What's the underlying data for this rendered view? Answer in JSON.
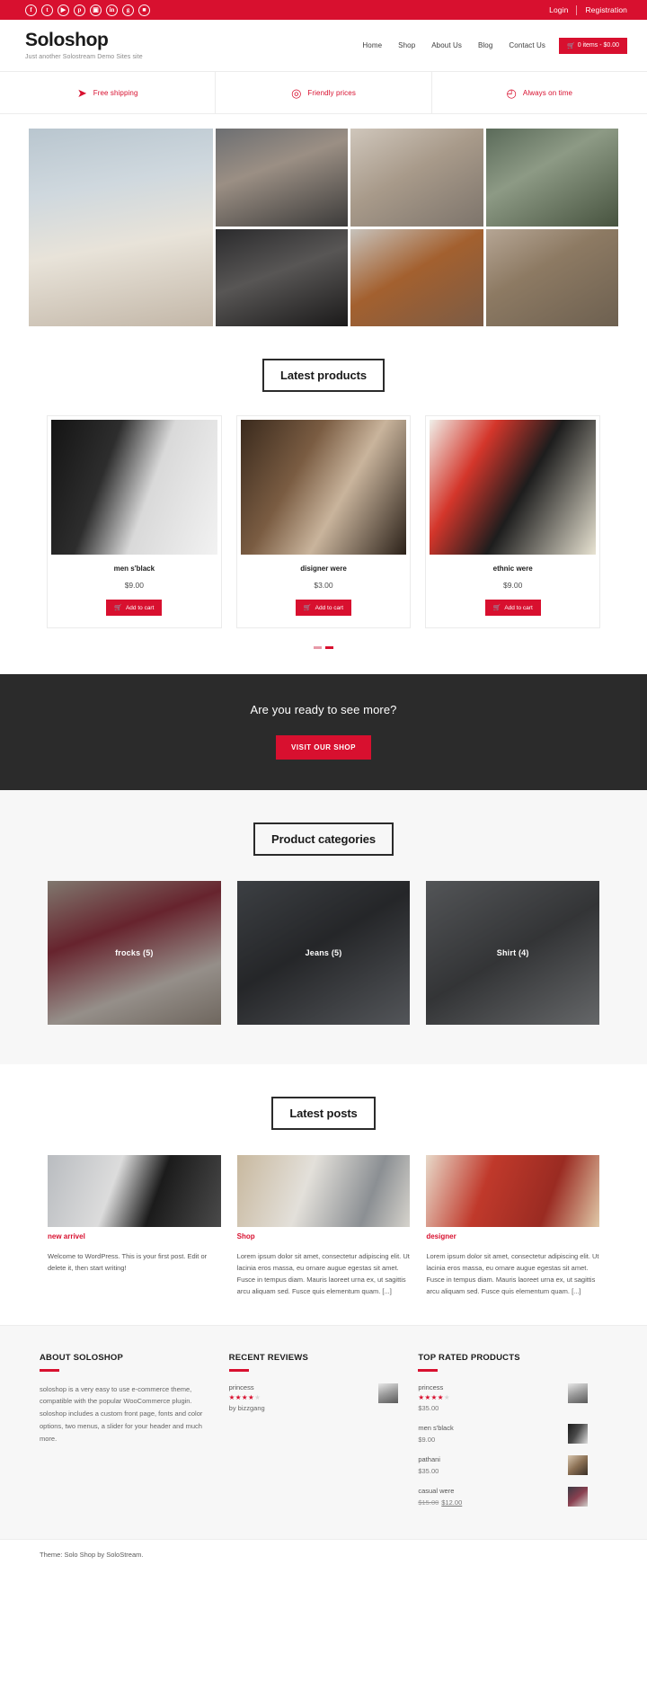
{
  "topbar": {
    "social": [
      {
        "name": "facebook-icon",
        "glyph": "f"
      },
      {
        "name": "twitter-icon",
        "glyph": "t"
      },
      {
        "name": "youtube-icon",
        "glyph": "▶"
      },
      {
        "name": "pinterest-icon",
        "glyph": "p"
      },
      {
        "name": "instagram-icon",
        "glyph": "▣"
      },
      {
        "name": "linkedin-icon",
        "glyph": "in"
      },
      {
        "name": "googleplus-icon",
        "glyph": "g"
      },
      {
        "name": "rss-icon",
        "glyph": "■"
      }
    ],
    "login": "Login",
    "registration": "Registration"
  },
  "header": {
    "site_title": "Soloshop",
    "tagline": "Just another Solostream Demo Sites site",
    "nav": [
      "Home",
      "Shop",
      "About Us",
      "Blog",
      "Contact Us"
    ],
    "cart": {
      "icon": "cart-icon",
      "label": "0 items - $0.00"
    }
  },
  "features": [
    {
      "icon": "rocket-icon",
      "glyph": "➤",
      "label": "Free shipping"
    },
    {
      "icon": "money-icon",
      "glyph": "◎",
      "label": "Friendly prices"
    },
    {
      "icon": "clock-icon",
      "glyph": "◴",
      "label": "Always on time"
    }
  ],
  "products_section": {
    "heading": "Latest products",
    "items": [
      {
        "name": "men s'black",
        "price": "$9.00",
        "button": "Add to cart",
        "img": "p1"
      },
      {
        "name": "disigner were",
        "price": "$3.00",
        "button": "Add to cart",
        "img": "p2"
      },
      {
        "name": "ethnic were",
        "price": "$9.00",
        "button": "Add to cart",
        "img": "p3"
      }
    ],
    "dots": 2,
    "active_dot": 1
  },
  "cta": {
    "title": "Are you ready to see more?",
    "button": "VISIT OUR SHOP"
  },
  "categories_section": {
    "heading": "Product categories",
    "items": [
      {
        "label": "frocks  (5)",
        "img": "c1"
      },
      {
        "label": "Jeans  (5)",
        "img": "c2"
      },
      {
        "label": "Shirt  (4)",
        "img": "c3"
      }
    ]
  },
  "posts_section": {
    "heading": "Latest posts",
    "items": [
      {
        "title": "new arrivel",
        "excerpt": "Welcome to WordPress. This is your first post. Edit or delete it, then start writing!",
        "img": "b1"
      },
      {
        "title": "Shop",
        "excerpt": "Lorem ipsum dolor sit amet, consectetur adipiscing elit. Ut lacinia eros massa, eu ornare augue egestas sit amet. Fusce in tempus diam. Mauris laoreet urna ex, ut sagittis arcu aliquam sed. Fusce quis elementum quam. [...]",
        "img": "b2"
      },
      {
        "title": "designer",
        "excerpt": "Lorem ipsum dolor sit amet, consectetur adipiscing elit. Ut lacinia eros massa, eu ornare augue egestas sit amet. Fusce in tempus diam. Mauris laoreet urna ex, ut sagittis arcu aliquam sed. Fusce quis elementum quam. [...]",
        "img": "b3"
      }
    ]
  },
  "footer": {
    "about": {
      "title": "ABOUT SOLOSHOP",
      "text": "soloshop is a very easy to use e-commerce theme, compatible with the popular WooCommerce plugin. soloshop includes a custom front page, fonts and color options, two menus, a slider for your header and much more."
    },
    "reviews": {
      "title": "RECENT REVIEWS",
      "items": [
        {
          "product": "princess",
          "rating": 4,
          "max": 5,
          "by": "by bizzgang",
          "thumb": "t1"
        }
      ]
    },
    "top_rated": {
      "title": "TOP RATED PRODUCTS",
      "items": [
        {
          "name": "princess",
          "rating": 4,
          "max": 5,
          "price": "$35.00",
          "thumb": "t1"
        },
        {
          "name": "men s'black",
          "rating": 0,
          "max": 5,
          "price": "$9.00",
          "thumb": "t2"
        },
        {
          "name": "pathani",
          "rating": 0,
          "max": 5,
          "price": "$35.00",
          "thumb": "t3"
        },
        {
          "name": "casual were",
          "rating": 0,
          "max": 5,
          "price_old": "$15.00",
          "price_new": "$12.00",
          "thumb": "t4"
        }
      ]
    }
  },
  "credit": "Theme: Solo Shop by SoloStream.",
  "colors": {
    "brand_red": "#d8102f",
    "dark": "#2b2b2b",
    "light_bg": "#f7f7f7"
  }
}
